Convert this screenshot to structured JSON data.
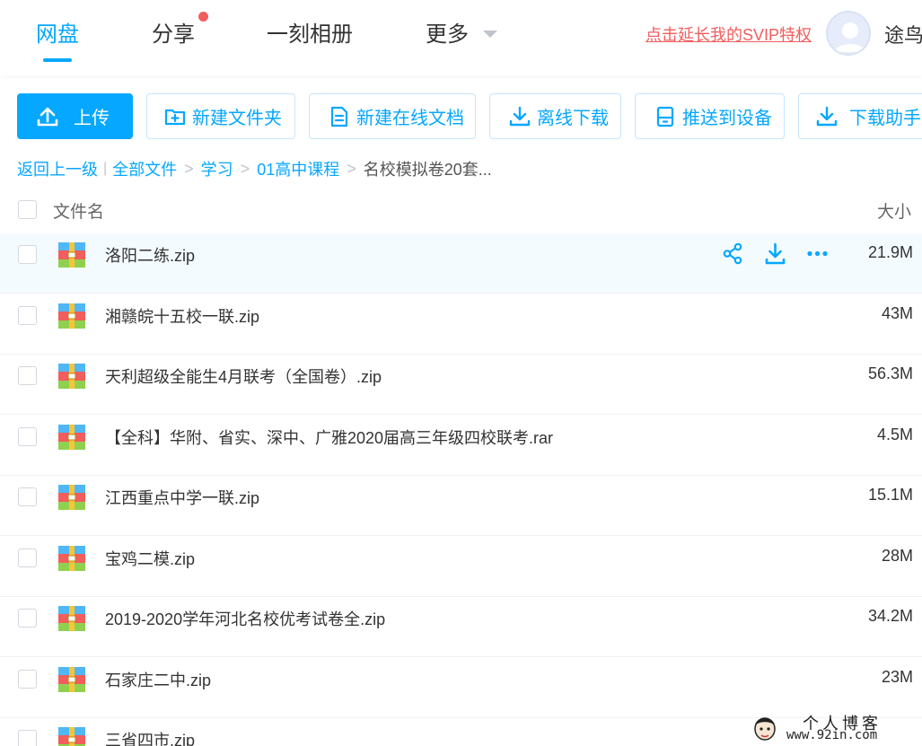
{
  "nav": {
    "tabs": [
      {
        "label": "网盘",
        "active": true
      },
      {
        "label": "分享",
        "has_badge_dot": true
      },
      {
        "label": "一刻相册"
      },
      {
        "label": "更多"
      }
    ],
    "promo_link": "点击延长我的SVIP特权",
    "username": "途鸟",
    "accent_color": "#06a7ff",
    "badge_color": "#f25d5d"
  },
  "toolbar": {
    "upload_label": "上传",
    "new_folder_label": "新建文件夹",
    "new_online_doc_label": "新建在线文档",
    "offline_download_label": "离线下载",
    "push_to_device_label": "推送到设备",
    "download_helper_label": "下载助手"
  },
  "breadcrumb": {
    "back_label": "返回上一级",
    "all_files_label": "全部文件",
    "path": [
      "学习",
      "01高中课程"
    ],
    "current": "名校模拟卷20套..."
  },
  "list": {
    "header_name": "文件名",
    "header_size": "大小",
    "rows": [
      {
        "name": "洛阳二练.zip",
        "size": "21.9M",
        "hovered": true,
        "icon": "zip-archive-icon"
      },
      {
        "name": "湘赣皖十五校一联.zip",
        "size": "43M",
        "icon": "zip-archive-icon"
      },
      {
        "name": "天利超级全能生4月联考（全国卷）.zip",
        "size": "56.3M",
        "icon": "zip-archive-icon"
      },
      {
        "name": "【全科】华附、省实、深中、广雅2020届高三年级四校联考.rar",
        "size": "4.5M",
        "icon": "zip-archive-icon"
      },
      {
        "name": "江西重点中学一联.zip",
        "size": "15.1M",
        "icon": "zip-archive-icon"
      },
      {
        "name": "宝鸡二模.zip",
        "size": "28M",
        "icon": "zip-archive-icon"
      },
      {
        "name": "2019-2020学年河北名校优考试卷全.zip",
        "size": "34.2M",
        "icon": "zip-archive-icon"
      },
      {
        "name": "石家庄二中.zip",
        "size": "23M",
        "icon": "zip-archive-icon"
      },
      {
        "name": "三省四市.zip",
        "size": "",
        "icon": "zip-archive-icon"
      }
    ],
    "row_actions": [
      "share-icon",
      "download-icon",
      "more-icon"
    ]
  },
  "watermark": {
    "title": "个人博客",
    "url": "www.92in.com"
  }
}
